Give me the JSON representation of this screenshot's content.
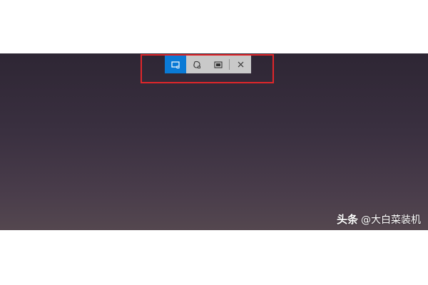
{
  "snip_toolbar": {
    "tools": [
      {
        "icon": "rectangle-snip-icon",
        "active": true
      },
      {
        "icon": "freeform-snip-icon",
        "active": false
      },
      {
        "icon": "window-snip-icon",
        "active": false
      },
      {
        "icon": "close-icon",
        "active": false
      }
    ],
    "colors": {
      "active": "#0a7ad6",
      "toolbar_bg": "#c9c9c9",
      "highlight": "#e0262a"
    }
  },
  "watermark": {
    "brand": "头条",
    "handle": "@大白菜装机"
  }
}
